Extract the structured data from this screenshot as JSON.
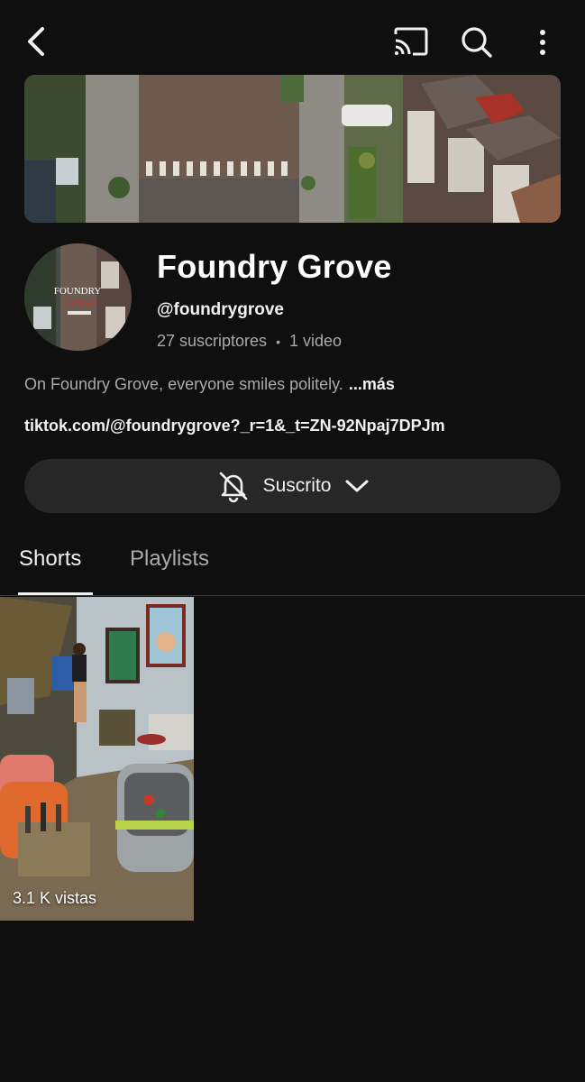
{
  "channel": {
    "name": "Foundry Grove",
    "handle": "@foundrygrove",
    "subscribers": "27 suscriptores",
    "videos": "1 video",
    "stats_separator": "•",
    "description": "On Foundry Grove, everyone smiles politely.",
    "more_label": "...más",
    "link": "tiktok.com/@foundrygrove?_r=1&_t=ZN-92Npaj7DPJm",
    "avatar_logo": {
      "line1": "FOUNDRY",
      "line2": "Grove"
    }
  },
  "subscribe": {
    "label": "Suscrito",
    "bell_icon": "bell-off-icon",
    "chevron_icon": "chevron-down-icon"
  },
  "tabs": [
    {
      "label": "Shorts",
      "active": true
    },
    {
      "label": "Playlists",
      "active": false
    }
  ],
  "shorts": [
    {
      "views": "3.1 K vistas"
    }
  ],
  "topbar": {
    "icons": [
      "back-icon",
      "cast-icon",
      "search-icon",
      "more-vert-icon"
    ]
  },
  "colors": {
    "background": "#0f0f0f",
    "button_bg": "#272727",
    "secondary_text": "#aaaaaa"
  }
}
